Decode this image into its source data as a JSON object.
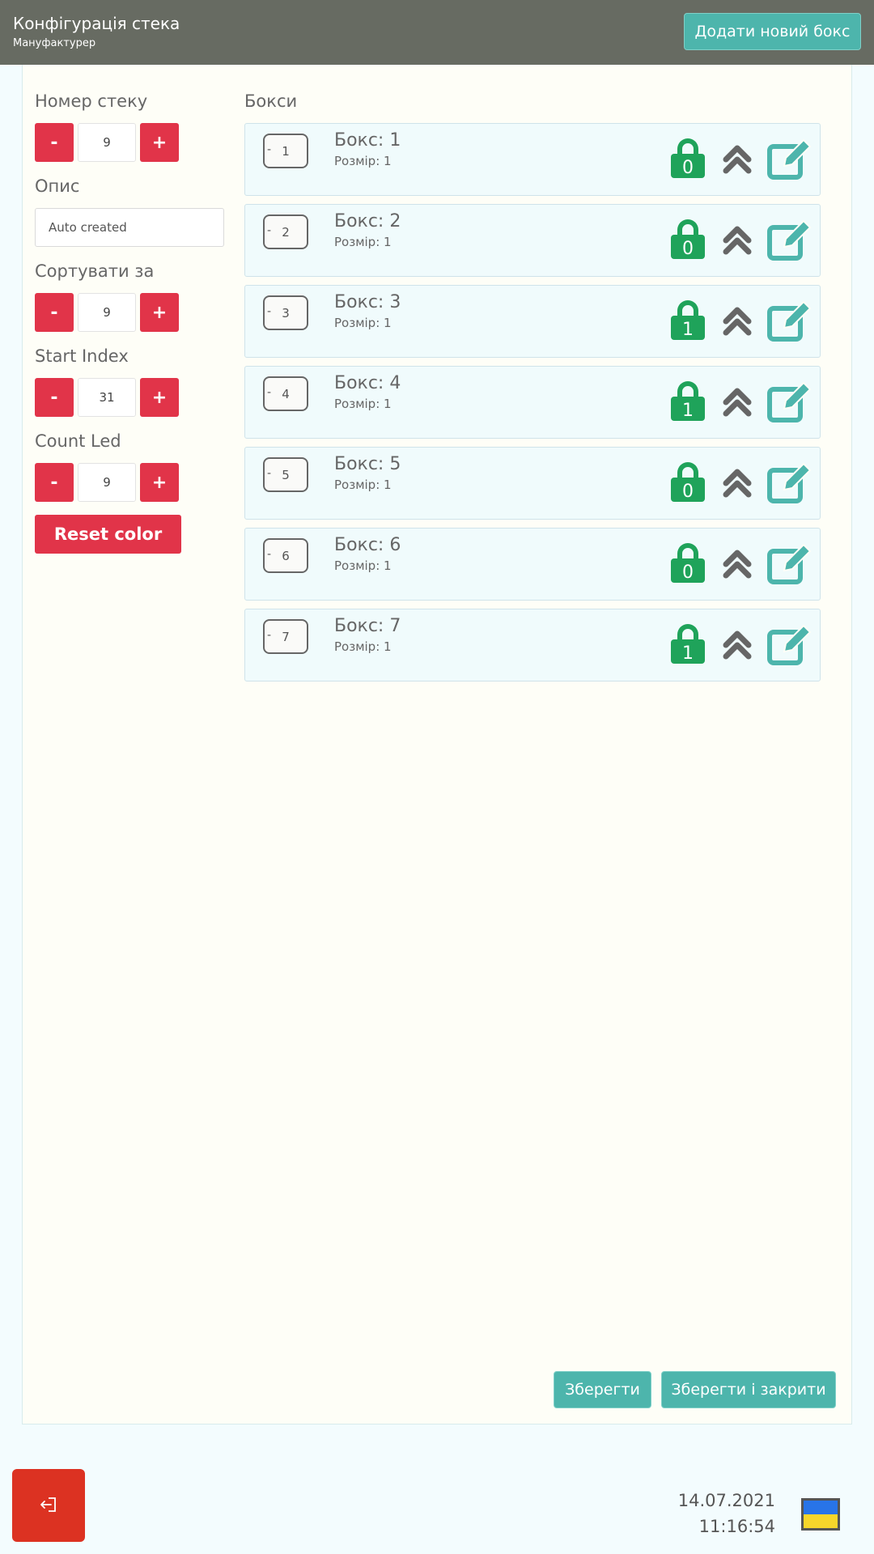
{
  "header": {
    "title": "Конфігурація стека",
    "subtitle": "Мануфактурер",
    "add_box_label": "Додати новий бокс"
  },
  "settings": {
    "stack_number": {
      "label": "Номер стеку",
      "value": "9"
    },
    "description": {
      "label": "Опис",
      "value": "Auto created"
    },
    "sort_by": {
      "label": "Сортувати за",
      "value": "9"
    },
    "start_index": {
      "label": "Start Index",
      "value": "31"
    },
    "count_led": {
      "label": "Count Led",
      "value": "9"
    },
    "minus_label": "-",
    "plus_label": "+",
    "reset_label": "Reset color"
  },
  "boxes": {
    "title": "Бокси",
    "items": [
      {
        "position": "1",
        "name": "Бокс: 1",
        "size": "Розмір: 1",
        "lock_count": "0"
      },
      {
        "position": "2",
        "name": "Бокс: 2",
        "size": "Розмір: 1",
        "lock_count": "0"
      },
      {
        "position": "3",
        "name": "Бокс: 3",
        "size": "Розмір: 1",
        "lock_count": "1"
      },
      {
        "position": "4",
        "name": "Бокс: 4",
        "size": "Розмір: 1",
        "lock_count": "1"
      },
      {
        "position": "5",
        "name": "Бокс: 5",
        "size": "Розмір: 1",
        "lock_count": "0"
      },
      {
        "position": "6",
        "name": "Бокс: 6",
        "size": "Розмір: 1",
        "lock_count": "0"
      },
      {
        "position": "7",
        "name": "Бокс: 7",
        "size": "Розмір: 1",
        "lock_count": "1"
      }
    ],
    "position_dash": "-"
  },
  "actions": {
    "save_label": "Зберегти",
    "save_close_label": "Зберегти і закрити"
  },
  "footer": {
    "date": "14.07.2021",
    "time": "11:16:54",
    "logout_icon": "logout-icon",
    "flag": "ukraine-flag"
  },
  "colors": {
    "header_bg": "#676b62",
    "accent_teal": "#4db5ac",
    "danger_red": "#e13449",
    "lock_green": "#1fa35a",
    "logout_red": "#dc3222"
  }
}
